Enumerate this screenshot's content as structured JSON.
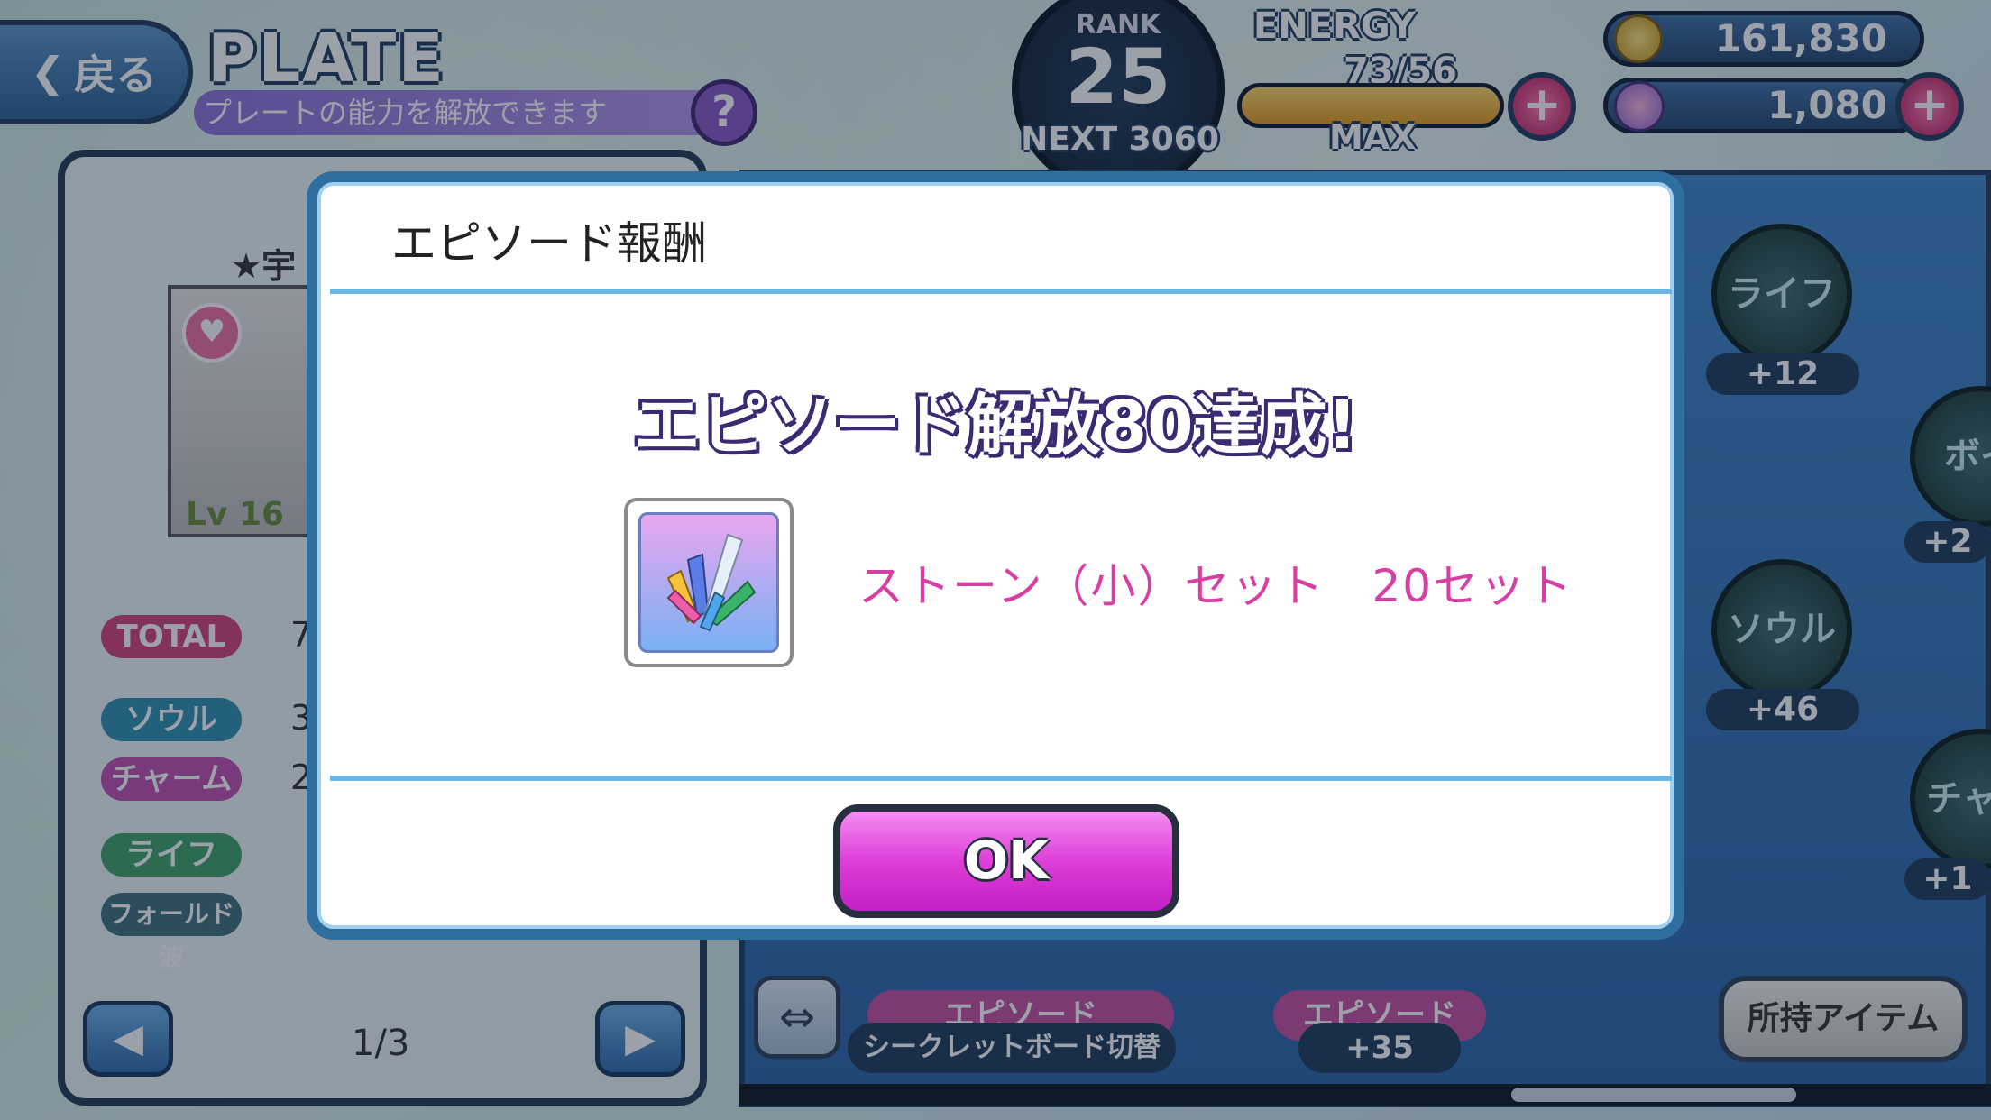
{
  "header": {
    "back_label": "戻る",
    "title": "PLATE",
    "subtitle": "プレートの能力を解放できます",
    "help_label": "?",
    "rank_label": "RANK",
    "rank_value": "25",
    "rank_next": "NEXT 3060",
    "energy_label": "ENERGY",
    "energy_value": "73/56",
    "energy_fill_fraction": 1.0,
    "energy_max": "MAX",
    "coins": "161,830",
    "gems": "1,080",
    "plus_label": "+"
  },
  "left_panel": {
    "plate_name": "★宇",
    "level": "Lv 16",
    "heart": "♥",
    "stats": [
      {
        "label": "TOTAL",
        "value": "7",
        "color": "#d4407a"
      },
      {
        "label": "ソウル",
        "value": "3",
        "color": "#2f8fb0"
      },
      {
        "label": "チャーム",
        "value": "2",
        "color": "#c14fb0"
      },
      {
        "label": "ライフ",
        "value": "",
        "color": "#3ea36a"
      },
      {
        "label": "フォールド波",
        "value": "",
        "color": "#3d6e7a"
      }
    ],
    "prev_label": "◀",
    "next_label": "▶",
    "page": "1/3"
  },
  "right_panel": {
    "nodes": [
      {
        "label": "ライフ",
        "bonus": "+12"
      },
      {
        "label": "ボイ",
        "bonus": "+2"
      },
      {
        "label": "ソウル",
        "bonus": "+46"
      },
      {
        "label": "チャー",
        "bonus": "+1"
      }
    ],
    "swap_label": "⇔",
    "secret_toggle": "シークレットボード切替",
    "episode_tag_1": "エピソード",
    "episode_tag_2": "エピソード",
    "episode_bonus": "+35",
    "items_button": "所持アイテム"
  },
  "modal": {
    "title": "エピソード報酬",
    "achievement": "エピソード解放80達成!",
    "reward_text": "ストーン（小）セット　20セット",
    "ok_label": "OK"
  }
}
